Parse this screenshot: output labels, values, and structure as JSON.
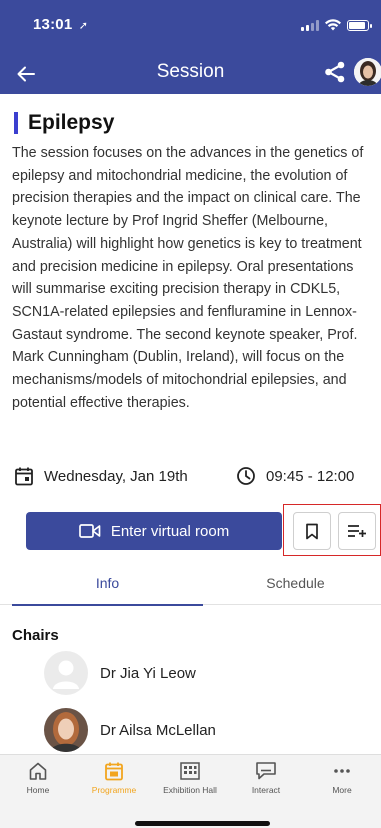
{
  "status_bar": {
    "time": "13:01",
    "location_glyph": "➚"
  },
  "nav": {
    "title": "Session"
  },
  "session": {
    "title": "Epilepsy",
    "description": "The session focuses on the advances in the genetics of epilepsy and mitochondrial medicine, the evolution of precision therapies and the impact on clinical care. The keynote lecture by Prof Ingrid Sheffer (Melbourne, Australia) will highlight how genetics is key to treatment and precision medicine in epilepsy. Oral presentations will summarise exciting precision therapy in CDKL5, SCN1A-related epilepsies and fenfluramine in Lennox-Gastaut syndrome. The second keynote speaker, Prof. Mark Cunningham (Dublin, Ireland), will focus on the mechanisms/models of mitochondrial epilepsies, and potential effective therapies.",
    "date": "Wednesday, Jan 19th",
    "time": "09:45 - 12:00"
  },
  "actions": {
    "enter_label": "Enter virtual room"
  },
  "tabs": [
    {
      "label": "Info",
      "active": true
    },
    {
      "label": "Schedule",
      "active": false
    }
  ],
  "chairs": {
    "heading": "Chairs",
    "people": [
      {
        "name": "Dr Jia Yi Leow",
        "avatar": "placeholder"
      },
      {
        "name": "Dr Ailsa McLellan",
        "avatar": "photo"
      }
    ]
  },
  "bottom_nav": [
    {
      "label": "Home",
      "icon": "home-icon",
      "active": false
    },
    {
      "label": "Programme",
      "icon": "calendar-icon",
      "active": true
    },
    {
      "label": "Exhibition Hall",
      "icon": "building-icon",
      "active": false
    },
    {
      "label": "Interact",
      "icon": "chat-icon",
      "active": false
    },
    {
      "label": "More",
      "icon": "more-icon",
      "active": false
    }
  ],
  "colors": {
    "primary": "#3b4a9c",
    "accent": "#f2a51e",
    "title_bar": "#3b3fcf",
    "highlight_box": "#d62828"
  }
}
